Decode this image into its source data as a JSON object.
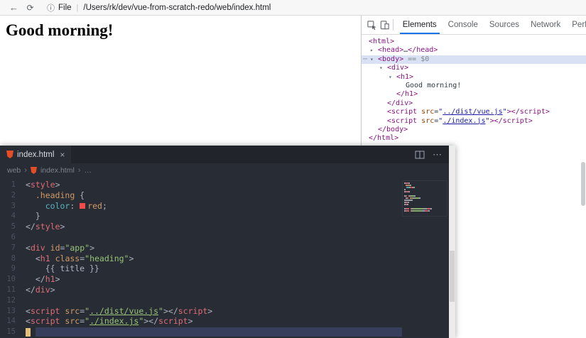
{
  "browser": {
    "back": "←",
    "reload": "⟳",
    "info": "ⓘ",
    "label": "File",
    "divider": "|",
    "path": "/Users/rk/dev/vue-from-scratch-redo/web/index.html"
  },
  "page": {
    "heading": "Good morning!"
  },
  "devtools": {
    "arrow_open": "▾",
    "arrow_closed": "▸",
    "dots": "⋯",
    "tabs": [
      {
        "label": "Elements",
        "selected": true
      },
      {
        "label": "Console",
        "selected": false
      },
      {
        "label": "Sources",
        "selected": false
      },
      {
        "label": "Network",
        "selected": false
      },
      {
        "label": "Performance",
        "selected": false
      }
    ],
    "tree": [
      {
        "indent": 0,
        "segs": [
          {
            "t": "<html>",
            "k": "tag"
          }
        ]
      },
      {
        "indent": 1,
        "arrow": "closed",
        "segs": [
          {
            "t": "<head>",
            "k": "tag"
          },
          {
            "t": "…",
            "k": "text"
          },
          {
            "t": "</head>",
            "k": "tag"
          }
        ]
      },
      {
        "indent": 1,
        "arrow": "open",
        "dots": true,
        "selected": true,
        "segs": [
          {
            "t": "<body>",
            "k": "tag"
          },
          {
            "t": " == $0",
            "k": "gray"
          }
        ]
      },
      {
        "indent": 2,
        "arrow": "open",
        "segs": [
          {
            "t": "<div>",
            "k": "tag"
          }
        ]
      },
      {
        "indent": 3,
        "arrow": "open",
        "segs": [
          {
            "t": "<h1>",
            "k": "tag"
          }
        ]
      },
      {
        "indent": 4,
        "segs": [
          {
            "t": "Good morning!",
            "k": "text"
          }
        ]
      },
      {
        "indent": 3,
        "segs": [
          {
            "t": "</h1>",
            "k": "tag"
          }
        ]
      },
      {
        "indent": 2,
        "segs": [
          {
            "t": "</div>",
            "k": "tag"
          }
        ]
      },
      {
        "indent": 2,
        "segs": [
          {
            "t": "<script",
            "k": "tag"
          },
          {
            "t": " src",
            "k": "attr"
          },
          {
            "t": "=",
            "k": "text"
          },
          {
            "t": "\"",
            "k": "val"
          },
          {
            "t": "../dist/vue.js",
            "k": "val",
            "u": true
          },
          {
            "t": "\"",
            "k": "val"
          },
          {
            "t": ">",
            "k": "tag"
          },
          {
            "t": "</script>",
            "k": "tag"
          }
        ]
      },
      {
        "indent": 2,
        "segs": [
          {
            "t": "<script",
            "k": "tag"
          },
          {
            "t": " src",
            "k": "attr"
          },
          {
            "t": "=",
            "k": "text"
          },
          {
            "t": "\"",
            "k": "val"
          },
          {
            "t": "./index.js",
            "k": "val",
            "u": true
          },
          {
            "t": "\"",
            "k": "val"
          },
          {
            "t": ">",
            "k": "tag"
          },
          {
            "t": "</script>",
            "k": "tag"
          }
        ]
      },
      {
        "indent": 1,
        "segs": [
          {
            "t": "</body>",
            "k": "tag"
          }
        ]
      },
      {
        "indent": 0,
        "segs": [
          {
            "t": "</html>",
            "k": "tag"
          }
        ]
      }
    ]
  },
  "vscode": {
    "tab": {
      "label": "index.html",
      "close": "×"
    },
    "actions": {
      "more": "⋯"
    },
    "breadcrumb": {
      "root": "web",
      "sep": "›",
      "file": "index.html",
      "more": "…"
    },
    "lines": [
      {
        "n": "1",
        "segs": [
          {
            "t": "<",
            "k": "punct"
          },
          {
            "t": "style",
            "k": "tag"
          },
          {
            "t": ">",
            "k": "punct"
          }
        ]
      },
      {
        "n": "2",
        "segs": [
          {
            "t": "  ",
            "k": "plain"
          },
          {
            "t": ".heading",
            "k": "sel"
          },
          {
            "t": " {",
            "k": "punct"
          }
        ]
      },
      {
        "n": "3",
        "segs": [
          {
            "t": "    ",
            "k": "plain"
          },
          {
            "t": "color",
            "k": "prop"
          },
          {
            "t": ": ",
            "k": "punct"
          },
          {
            "swatch": true
          },
          {
            "t": "red",
            "k": "const"
          },
          {
            "t": ";",
            "k": "punct"
          }
        ]
      },
      {
        "n": "4",
        "segs": [
          {
            "t": "  }",
            "k": "punct"
          }
        ]
      },
      {
        "n": "5",
        "segs": [
          {
            "t": "</",
            "k": "punct"
          },
          {
            "t": "style",
            "k": "tag"
          },
          {
            "t": ">",
            "k": "punct"
          }
        ]
      },
      {
        "n": "6",
        "segs": []
      },
      {
        "n": "7",
        "segs": [
          {
            "t": "<",
            "k": "punct"
          },
          {
            "t": "div",
            "k": "tag"
          },
          {
            "t": " ",
            "k": "plain"
          },
          {
            "t": "id",
            "k": "attr"
          },
          {
            "t": "=",
            "k": "punct"
          },
          {
            "t": "\"app\"",
            "k": "str"
          },
          {
            "t": ">",
            "k": "punct"
          }
        ]
      },
      {
        "n": "8",
        "segs": [
          {
            "t": "  ",
            "k": "plain"
          },
          {
            "t": "<",
            "k": "punct"
          },
          {
            "t": "h1",
            "k": "tag"
          },
          {
            "t": " ",
            "k": "plain"
          },
          {
            "t": "class",
            "k": "attr"
          },
          {
            "t": "=",
            "k": "punct"
          },
          {
            "t": "\"heading\"",
            "k": "str"
          },
          {
            "t": ">",
            "k": "punct"
          }
        ]
      },
      {
        "n": "9",
        "segs": [
          {
            "t": "    {{ title }}",
            "k": "plain"
          }
        ]
      },
      {
        "n": "10",
        "segs": [
          {
            "t": "  </",
            "k": "punct"
          },
          {
            "t": "h1",
            "k": "tag"
          },
          {
            "t": ">",
            "k": "punct"
          }
        ]
      },
      {
        "n": "11",
        "segs": [
          {
            "t": "</",
            "k": "punct"
          },
          {
            "t": "div",
            "k": "tag"
          },
          {
            "t": ">",
            "k": "punct"
          }
        ]
      },
      {
        "n": "12",
        "segs": []
      },
      {
        "n": "13",
        "segs": [
          {
            "t": "<",
            "k": "punct"
          },
          {
            "t": "script",
            "k": "tag"
          },
          {
            "t": " ",
            "k": "plain"
          },
          {
            "t": "src",
            "k": "attr"
          },
          {
            "t": "=",
            "k": "punct"
          },
          {
            "t": "\"",
            "k": "str"
          },
          {
            "t": "../dist/vue.js",
            "k": "str",
            "u": true
          },
          {
            "t": "\"",
            "k": "str"
          },
          {
            "t": ">",
            "k": "punct"
          },
          {
            "t": "</",
            "k": "punct"
          },
          {
            "t": "script",
            "k": "tag"
          },
          {
            "t": ">",
            "k": "punct"
          }
        ]
      },
      {
        "n": "14",
        "segs": [
          {
            "t": "<",
            "k": "punct"
          },
          {
            "t": "script",
            "k": "tag"
          },
          {
            "t": " ",
            "k": "plain"
          },
          {
            "t": "src",
            "k": "attr"
          },
          {
            "t": "=",
            "k": "punct"
          },
          {
            "t": "\"",
            "k": "str"
          },
          {
            "t": "./index.js",
            "k": "str",
            "u": true
          },
          {
            "t": "\"",
            "k": "str"
          },
          {
            "t": ">",
            "k": "punct"
          },
          {
            "t": "</",
            "k": "punct"
          },
          {
            "t": "script",
            "k": "tag"
          },
          {
            "t": ">",
            "k": "punct"
          }
        ]
      },
      {
        "n": "15",
        "current": true,
        "cursor": true,
        "segs": []
      }
    ]
  },
  "colors": {
    "dt_tag": "#881280",
    "dt_attr": "#994500",
    "dt_val": "#1a1aa6",
    "dt_text": "#303942",
    "dt_gray": "#80868b",
    "dt_selected_bg": "#d9e2f5",
    "dt_tab_accent": "#1a73e8",
    "vs_bg": "#282c34",
    "vs_bar_bg": "#21252b",
    "vs_tag": "#e06c75",
    "vs_attr": "#d19a66",
    "vs_str": "#98c379",
    "vs_punct": "#abb2bf",
    "vs_sel": "#d19a66",
    "vs_prop": "#56b6c2",
    "vs_const": "#d19a66",
    "vs_plain": "#abb2bf",
    "vs_gutter": "#4b5263",
    "vs_current_line": "#363e5c",
    "vs_cursor": "#e5c07b",
    "swatch_red": "#f14c4c",
    "html_icon": "#e44d26"
  }
}
